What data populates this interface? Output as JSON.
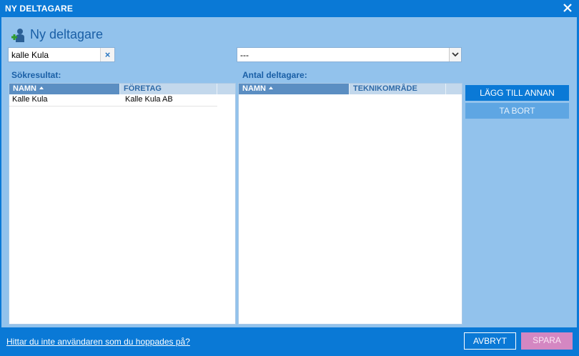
{
  "window": {
    "title": "NY DELTAGARE"
  },
  "heading": "Ny deltagare",
  "search": {
    "value": "kalle Kula",
    "clear_label": "×"
  },
  "dropdown": {
    "selected": "---"
  },
  "left_panel": {
    "label": "Sökresultat:",
    "columns": [
      "NAMN",
      "FÖRETAG"
    ],
    "rows": [
      {
        "name": "Kalle Kula",
        "company": "Kalle Kula AB"
      }
    ]
  },
  "right_panel": {
    "label": "Antal deltagare:",
    "columns": [
      "NAMN",
      "TEKNIKOMRÅDE"
    ]
  },
  "actions": {
    "add_other": "LÄGG TILL ANNAN",
    "remove": "TA BORT"
  },
  "footer": {
    "link": "Hittar du inte användaren som du hoppades på?",
    "cancel": "AVBRYT",
    "save": "SPARA"
  },
  "colors": {
    "titlebar": "#0a79d6",
    "panel": "#92c2ec",
    "save": "#d487c2"
  }
}
